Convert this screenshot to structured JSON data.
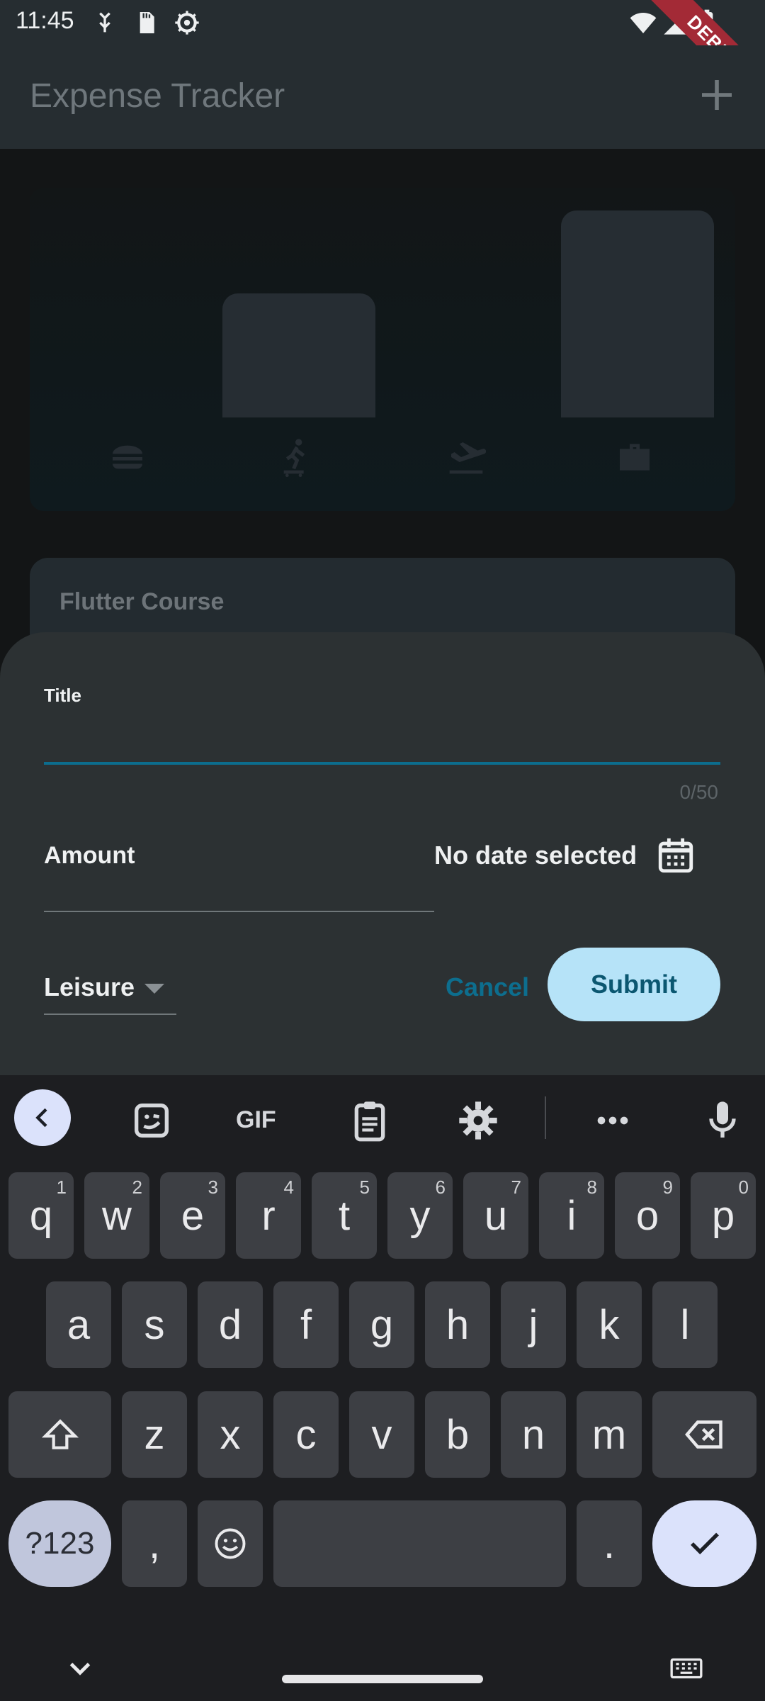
{
  "status_bar": {
    "time": "11:45"
  },
  "debug_banner": "DEBUG",
  "app_bar": {
    "title": "Expense Tracker"
  },
  "chart": {
    "categories": [
      "food-icon",
      "leisure-icon",
      "travel-icon",
      "work-icon"
    ],
    "values": [
      0,
      0.6,
      0,
      1
    ]
  },
  "expense_list": {
    "first_title": "Flutter Course"
  },
  "form": {
    "title_label": "Title",
    "title_value": "",
    "title_counter": "0/50",
    "amount_label": "Amount",
    "date_text": "No date selected",
    "category_selected": "Leisure",
    "cancel_label": "Cancel",
    "submit_label": "Submit"
  },
  "keyboard": {
    "row1": [
      {
        "k": "q",
        "n": "1"
      },
      {
        "k": "w",
        "n": "2"
      },
      {
        "k": "e",
        "n": "3"
      },
      {
        "k": "r",
        "n": "4"
      },
      {
        "k": "t",
        "n": "5"
      },
      {
        "k": "y",
        "n": "6"
      },
      {
        "k": "u",
        "n": "7"
      },
      {
        "k": "i",
        "n": "8"
      },
      {
        "k": "o",
        "n": "9"
      },
      {
        "k": "p",
        "n": "0"
      }
    ],
    "row2": [
      "a",
      "s",
      "d",
      "f",
      "g",
      "h",
      "j",
      "k",
      "l"
    ],
    "row3": [
      "z",
      "x",
      "c",
      "v",
      "b",
      "n",
      "m"
    ],
    "symbols_label": "?123",
    "comma": ",",
    "period": ".",
    "gif_label": "GIF"
  }
}
